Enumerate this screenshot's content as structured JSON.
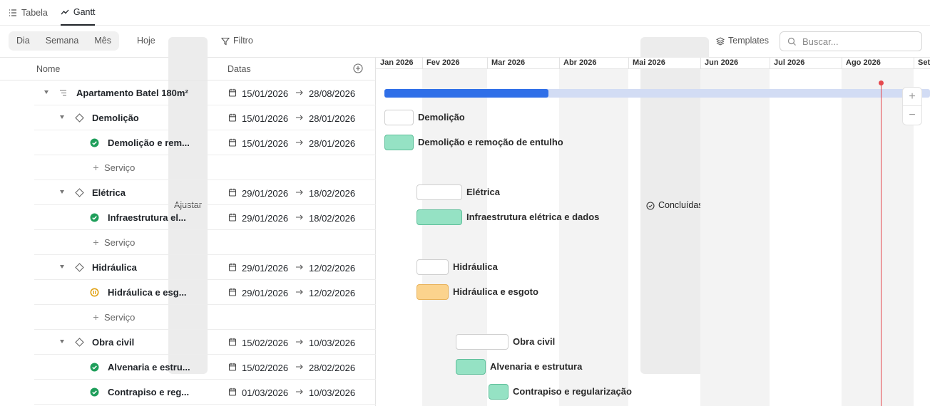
{
  "view_tabs": [
    {
      "label": "Tabela",
      "icon": "list-icon",
      "active": false
    },
    {
      "label": "Gantt",
      "icon": "chart-line-icon",
      "active": true
    }
  ],
  "toolbar": {
    "scale": [
      "Dia",
      "Semana",
      "Mês"
    ],
    "today_label": "Hoje",
    "fit_label": "Ajustar",
    "filter_label": "Filtro",
    "completed_label": "Concluídas",
    "templates_label": "Templates",
    "search_placeholder": "Buscar..."
  },
  "table": {
    "col_name": "Nome",
    "col_dates": "Datas",
    "rows": [
      {
        "kind": "project",
        "name": "Apartamento Batel 180m²",
        "start": "15/01/2026",
        "end": "28/08/2026"
      },
      {
        "kind": "phase",
        "name": "Demolição",
        "start": "15/01/2026",
        "end": "28/01/2026"
      },
      {
        "kind": "task",
        "status": "done",
        "name": "Demolição e rem...",
        "start": "15/01/2026",
        "end": "28/01/2026"
      },
      {
        "kind": "add",
        "name": "Serviço"
      },
      {
        "kind": "phase",
        "name": "Elétrica",
        "start": "29/01/2026",
        "end": "18/02/2026"
      },
      {
        "kind": "task",
        "status": "done",
        "name": "Infraestrutura el...",
        "start": "29/01/2026",
        "end": "18/02/2026"
      },
      {
        "kind": "add",
        "name": "Serviço"
      },
      {
        "kind": "phase",
        "name": "Hidráulica",
        "start": "29/01/2026",
        "end": "12/02/2026"
      },
      {
        "kind": "task",
        "status": "progress",
        "name": "Hidráulica e esg...",
        "start": "29/01/2026",
        "end": "12/02/2026"
      },
      {
        "kind": "add",
        "name": "Serviço"
      },
      {
        "kind": "phase",
        "name": "Obra civil",
        "start": "15/02/2026",
        "end": "10/03/2026"
      },
      {
        "kind": "task",
        "status": "done",
        "name": "Alvenaria e estru...",
        "start": "15/02/2026",
        "end": "28/02/2026"
      },
      {
        "kind": "task",
        "status": "done",
        "name": "Contrapiso e reg...",
        "start": "01/03/2026",
        "end": "10/03/2026"
      }
    ]
  },
  "timeline": {
    "months": [
      "Jan 2026",
      "Fev 2026",
      "Mar 2026",
      "Abr 2026",
      "Mai 2026",
      "Jun 2026",
      "Jul 2026",
      "Ago 2026",
      "Set"
    ],
    "project_progress": 0.3,
    "bars": [
      {
        "row": 1,
        "type": "group",
        "label": "Demolição"
      },
      {
        "row": 2,
        "type": "ok",
        "label": "Demolição e remoção de entulho"
      },
      {
        "row": 4,
        "type": "group",
        "label": "Elétrica"
      },
      {
        "row": 5,
        "type": "ok",
        "label": "Infraestrutura elétrica e dados"
      },
      {
        "row": 7,
        "type": "group",
        "label": "Hidráulica"
      },
      {
        "row": 8,
        "type": "warn",
        "label": "Hidráulica e esgoto"
      },
      {
        "row": 10,
        "type": "group",
        "label": "Obra civil"
      },
      {
        "row": 11,
        "type": "ok",
        "label": "Alvenaria e estrutura"
      },
      {
        "row": 12,
        "type": "ok",
        "label": "Contrapiso e regularização"
      }
    ],
    "zoom_in": "+",
    "zoom_out": "−"
  }
}
